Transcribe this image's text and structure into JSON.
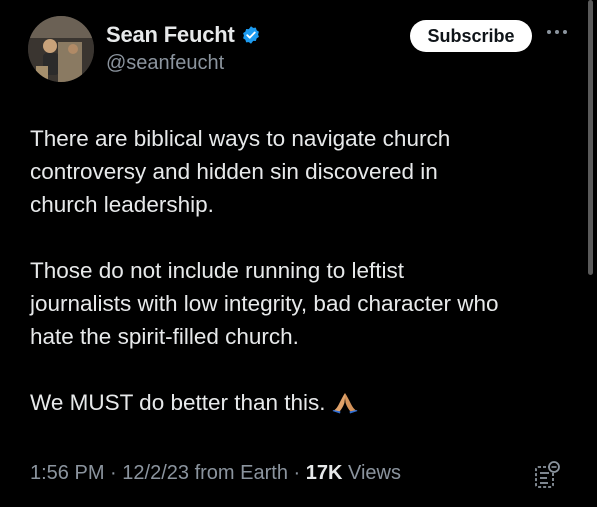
{
  "author": {
    "name": "Sean Feucht",
    "handle": "@seanfeucht"
  },
  "actions": {
    "subscribe_label": "Subscribe"
  },
  "post": {
    "paragraphs": [
      "There are biblical ways to navigate church\ncontroversy and hidden sin discovered in\nchurch leadership.",
      "Those do not include running to leftist\njournalists with low integrity, bad character who\nhate the spirit-filled church.",
      "We MUST do better than this."
    ]
  },
  "meta": {
    "time": "1:56 PM",
    "separator": "·",
    "date": "12/2/23",
    "source": "from Earth",
    "views_count": "17K",
    "views_label": "Views"
  },
  "icons": {
    "verified": "verified-badge-icon",
    "more": "more-dots-icon",
    "emoji": "praying-hands-icon",
    "notes": "notes-icon"
  },
  "colors": {
    "background": "#000000",
    "text": "#e7e9ea",
    "muted": "#8b949e",
    "verified_blue": "#1d9bf0",
    "subscribe_bg": "#ffffff"
  }
}
